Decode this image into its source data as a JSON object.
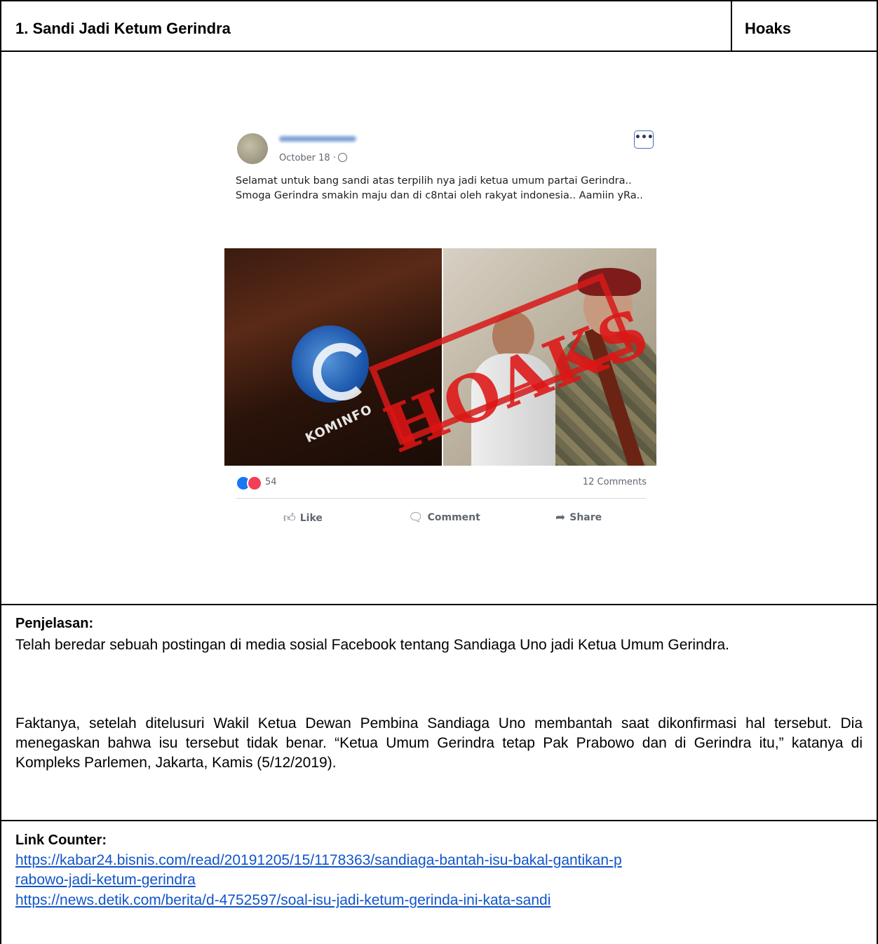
{
  "table": {
    "title": "1. Sandi Jadi Ketum Gerindra",
    "verdict": "Hoaks"
  },
  "post": {
    "date": "October 18 ·",
    "more_label": "•••",
    "text_line1": "Selamat untuk bang sandi atas terpilih nya jadi ketua umum partai Gerindra..",
    "text_line2": "Smoga Gerindra smakin maju dan di c8ntai oleh rakyat indonesia.. Aamiin yRa..",
    "stamp": "HOAKS",
    "logo_text": "KOMINFO",
    "reaction_count": "54",
    "comments_count": "12 Comments",
    "like_label": "Like",
    "comment_label": "Comment",
    "share_label": "Share",
    "colors": {
      "like": "#1877f2",
      "love": "#f33e58",
      "stamp": "#de1414"
    },
    "icons": [
      "globe-icon",
      "like-icon",
      "comment-icon",
      "share-icon"
    ]
  },
  "explanation": {
    "heading": "Penjelasan:",
    "p1": "Telah beredar sebuah postingan di media sosial Facebook tentang Sandiaga Uno jadi Ketua Umum Gerindra.",
    "p2": "Faktanya, setelah ditelusuri Wakil Ketua Dewan Pembina Sandiaga Uno membantah saat dikonfirmasi hal tersebut. Dia menegaskan bahwa isu tersebut tidak benar. “Ketua Umum Gerindra tetap Pak Prabowo dan di Gerindra itu,” katanya di Kompleks Parlemen, Jakarta, Kamis (5/12/2019)."
  },
  "counter": {
    "heading": "Link Counter:",
    "link1_a": "https://kabar24.bisnis.com/read/20191205/15/1178363/sandiaga-bantah-isu-bakal-gantikan-p",
    "link1_b": "rabowo-jadi-ketum-gerindra",
    "link2": "https://news.detik.com/berita/d-4752597/soal-isu-jadi-ketum-gerinda-ini-kata-sandi"
  }
}
